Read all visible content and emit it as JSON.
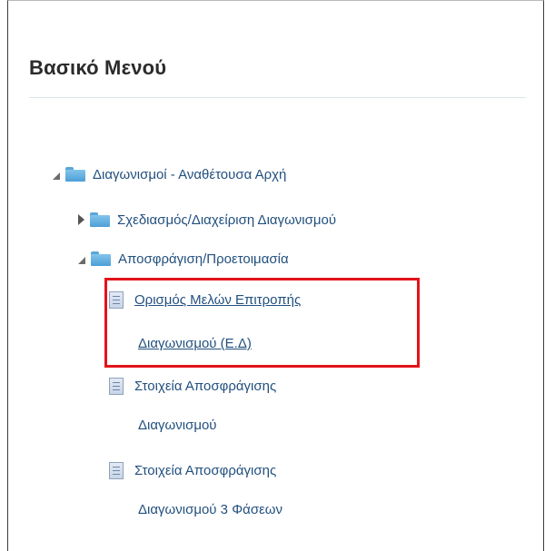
{
  "panel": {
    "title": "Βασικό Μενού"
  },
  "tree": {
    "root": {
      "label": "Διαγωνισμοί - Αναθέτουσα Αρχή",
      "expanded": true,
      "icon": "folder-icon"
    },
    "children": [
      {
        "label": "Σχεδιασμός/Διαχείριση Διαγωνισμού",
        "expanded": false,
        "icon": "folder-icon"
      },
      {
        "label": "Αποσφράγιση/Προετοιμασία",
        "expanded": true,
        "icon": "folder-icon",
        "items": [
          {
            "line1": "Ορισμός Μελών Επιτροπής",
            "line2": "Διαγωνισμού (Ε.Δ)",
            "icon": "document-icon",
            "highlighted": true
          },
          {
            "line1": "Στοιχεία Αποσφράγισης",
            "line2": "Διαγωνισμού",
            "icon": "document-icon"
          },
          {
            "line1": "Στοιχεία Αποσφράγισης",
            "line2": "Διαγωνισμού 3 Φάσεων",
            "icon": "document-icon"
          }
        ]
      }
    ]
  },
  "colors": {
    "link": "#22507e",
    "highlight_border": "#e3131a",
    "folder": "#4b9fd6",
    "title": "#2b2b2b"
  }
}
